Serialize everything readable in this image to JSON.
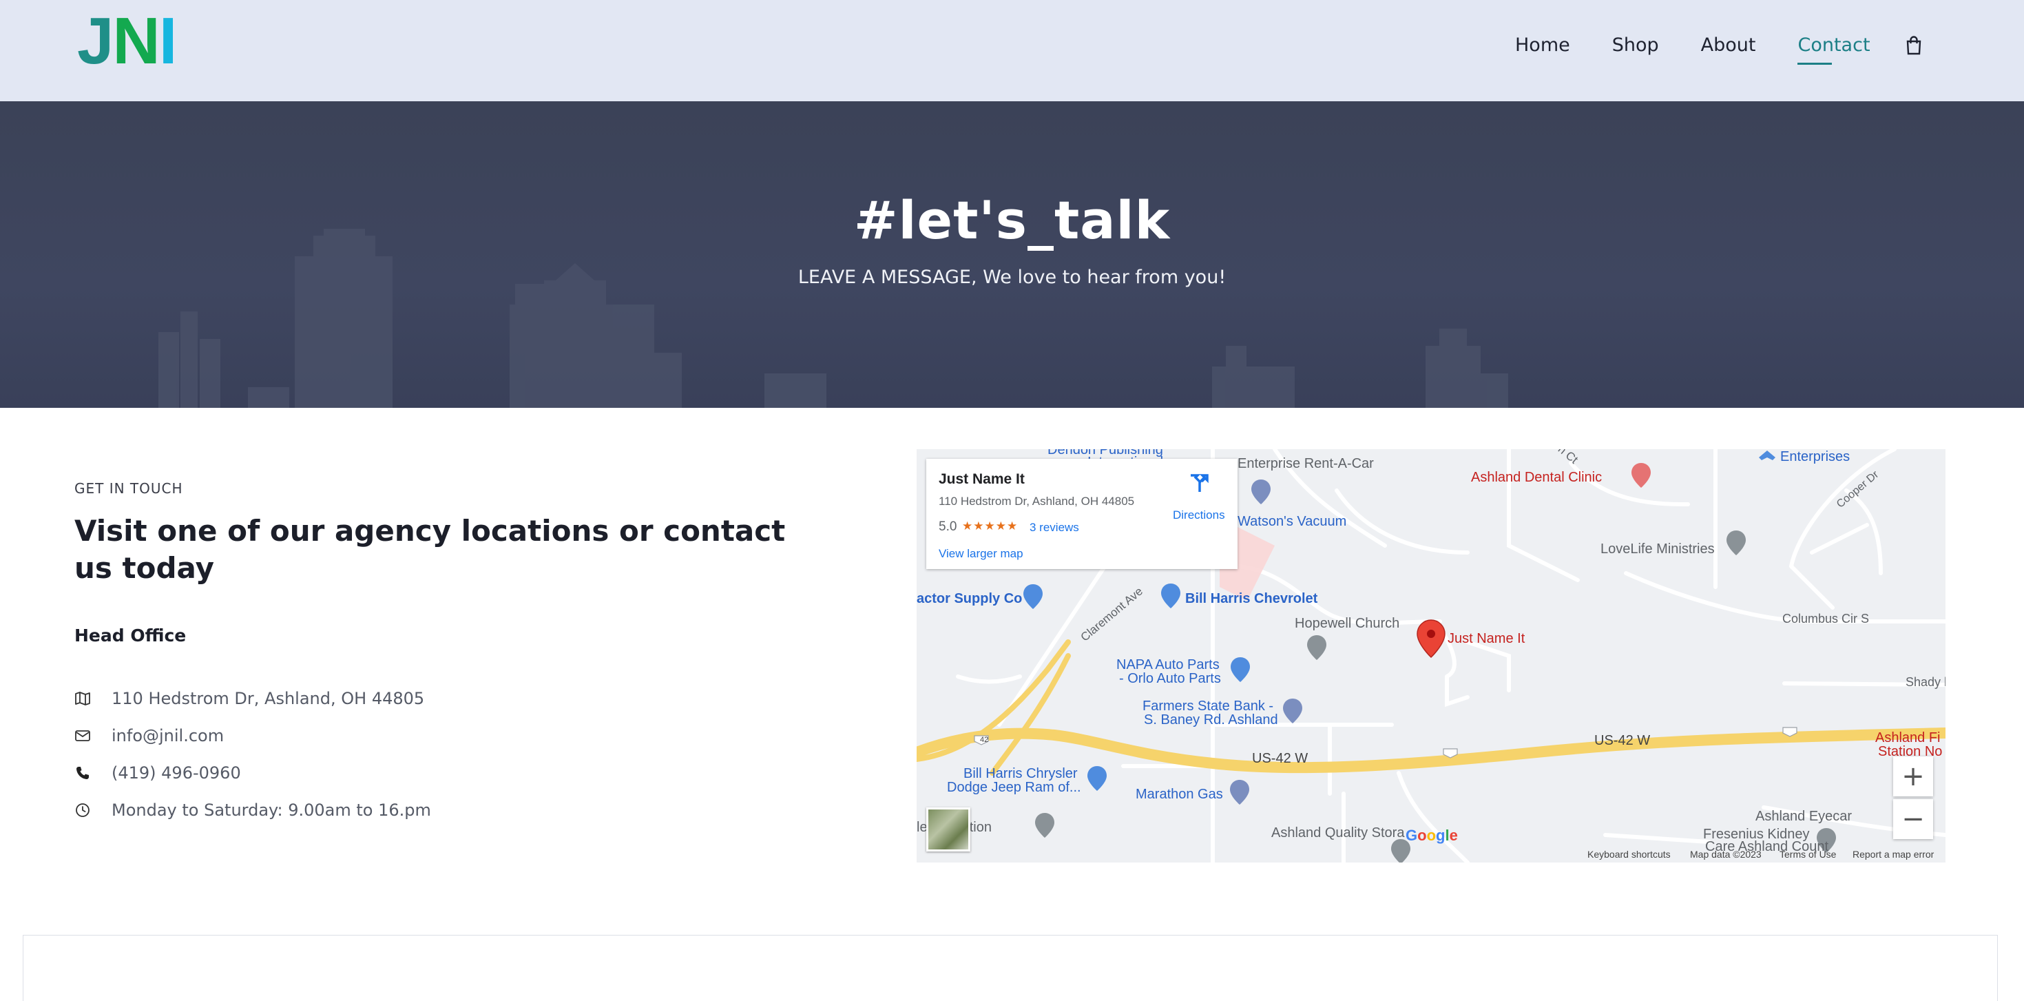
{
  "header": {
    "logo": {
      "part1": "J",
      "part2": "N",
      "part3": "I"
    },
    "nav": [
      {
        "label": "Home",
        "active": false
      },
      {
        "label": "Shop",
        "active": false
      },
      {
        "label": "About",
        "active": false
      },
      {
        "label": "Contact",
        "active": true
      }
    ],
    "cart_icon": "shopping-bag-icon"
  },
  "hero": {
    "title": "#let's_talk",
    "subtitle": "LEAVE A MESSAGE, We love to hear from you!"
  },
  "contact": {
    "eyebrow": "GET IN TOUCH",
    "heading": "Visit one of our agency locations or contact us today",
    "office_title": "Head Office",
    "items": [
      {
        "icon": "map-icon",
        "text": "110 Hedstrom Dr, Ashland, OH 44805"
      },
      {
        "icon": "envelope-icon",
        "text": "info@jnil.com"
      },
      {
        "icon": "phone-icon",
        "text": "(419) 496-0960"
      },
      {
        "icon": "clock-icon",
        "text": "Monday to Saturday: 9.00am to 16.pm"
      }
    ]
  },
  "map": {
    "card": {
      "name": "Just Name It",
      "address": "110 Hedstrom Dr, Ashland, OH 44805",
      "rating": "5.0",
      "stars": "★★★★★",
      "reviews": "3 reviews",
      "larger_map": "View larger map",
      "directions": "Directions"
    },
    "labels": {
      "dendon": "Dendon Publishing",
      "dendon2": "International",
      "enterprise": "Enterprise Rent-A-Car",
      "ct": "n Ct",
      "enterprises": "Enterprises",
      "dental": "Ashland Dental Clinic",
      "cooper": "Cooper Dr",
      "watsons": "Watson's Vacuum",
      "lovelife": "LoveLife Ministries",
      "tractor": "actor Supply Co",
      "claremont": "Claremont Ave",
      "billharris": "Bill Harris Chevrolet",
      "hopewell": "Hopewell Church",
      "justnameit": "Just Name It",
      "columbus": "Columbus Cir S",
      "shady": "Shady l",
      "napa1": "NAPA Auto Parts",
      "napa2": "- Orlo Auto Parts",
      "farmers1": "Farmers State Bank -",
      "farmers2": "S. Baney Rd. Ashland",
      "us42a": "US-42 W",
      "us42b": "US-42 W",
      "route42": "42",
      "ashlandfi1": "Ashland Fi",
      "ashlandfi2": "Station No",
      "chrysler1": "Bill Harris Chrysler",
      "chrysler2": "Dodge Jeep Ram of...",
      "marathon": "Marathon Gas",
      "transportation": "le   sportation",
      "quality": "Ashland Quality Stora",
      "fresenius": "Fresenius Kidney",
      "eyecare": "Ashland Eyecar",
      "careashland": "Care Ashland Count"
    },
    "attribution": {
      "shortcuts": "Keyboard shortcuts",
      "mapdata": "Map data ©2023",
      "terms": "Terms of Use",
      "report": "Report a map error"
    },
    "google": "Google",
    "zoom_in": "+",
    "zoom_out": "−"
  },
  "colors": {
    "header_bg": "#e2e7f3",
    "hero_bg": "#3f4660",
    "accent": "#1c7f86",
    "map_road": "#f6d36b"
  }
}
